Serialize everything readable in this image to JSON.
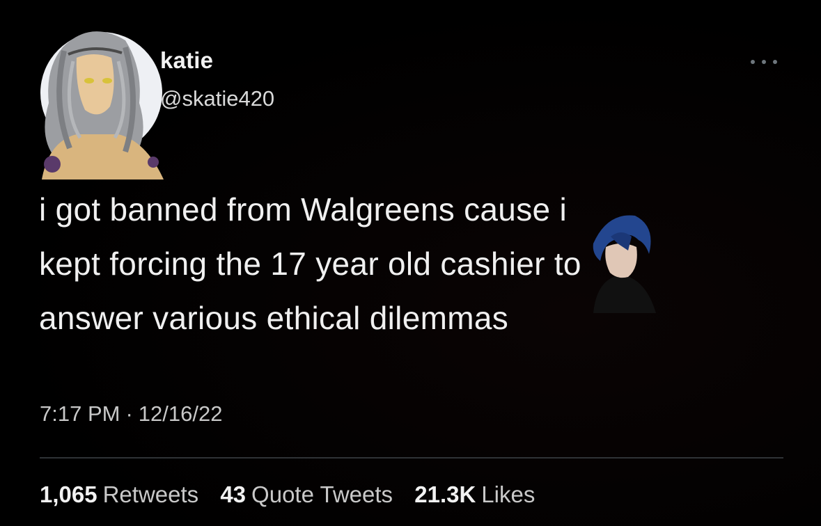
{
  "author": {
    "display_name": "katie",
    "handle": "@skatie420",
    "avatar_icon": "anime-character-avatar"
  },
  "tweet": {
    "lines": [
      "i got banned from Walgreens cause i",
      "kept forcing the 17 year old cashier to",
      "answer various ethical dilemmas"
    ],
    "time": "7:17 PM",
    "separator": "·",
    "date": "12/16/22"
  },
  "stats": {
    "retweets_count": "1,065",
    "retweets_label": "Retweets",
    "quotes_count": "43",
    "quotes_label": "Quote Tweets",
    "likes_count": "21.3K",
    "likes_label": "Likes"
  },
  "icons": {
    "more": "more-options-icon",
    "sticker": "anime-boy-sticker"
  },
  "colors": {
    "background": "#000000",
    "text": "#e7e9ea",
    "secondary": "#c9c9c9",
    "divider": "#2f3336"
  }
}
